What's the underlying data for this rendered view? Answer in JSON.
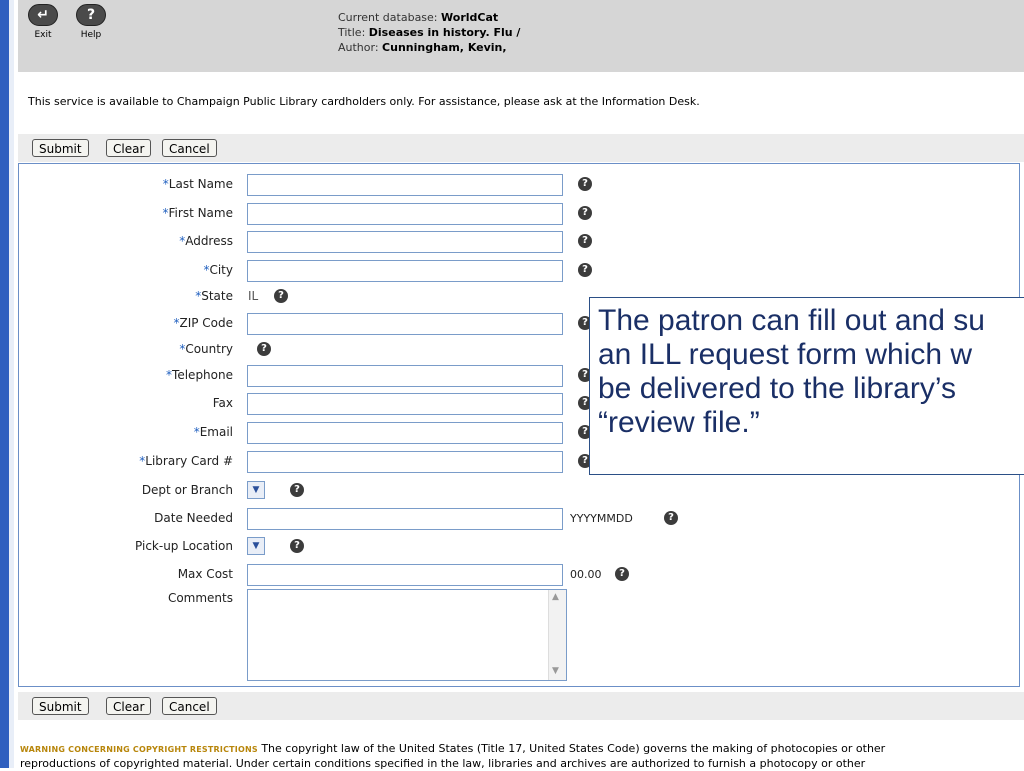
{
  "header": {
    "exit_label": "Exit",
    "help_label": "Help",
    "db_prefix": "Current database:",
    "db_value": "WorldCat",
    "title_prefix": "Title:",
    "title_value": "Diseases in history. Flu /",
    "author_prefix": "Author:",
    "author_value": "Cunningham, Kevin,"
  },
  "notice": "This service is available to Champaign Public Library cardholders only. For assistance, please ask at the Information Desk.",
  "buttons": {
    "submit": "Submit",
    "clear": "Clear",
    "cancel": "Cancel"
  },
  "form": {
    "last_name": "Last Name",
    "first_name": "First Name",
    "address": "Address",
    "city": "City",
    "state": "State",
    "state_value": "IL",
    "zip": "ZIP Code",
    "country": "Country",
    "telephone": "Telephone",
    "fax": "Fax",
    "email": "Email",
    "library_card": "Library Card #",
    "dept_branch": "Dept or Branch",
    "date_needed": "Date Needed",
    "date_format": "YYYYMMDD",
    "pickup": "Pick-up Location",
    "max_cost": "Max Cost",
    "max_cost_value": "00.00",
    "comments": "Comments",
    "required_mark": "*"
  },
  "callout": {
    "line1": "The patron can fill out and su",
    "line2": "an ILL request form which w",
    "line3": "be delivered to the library’s",
    "line4": "“review file.”"
  },
  "warning": {
    "heading": "WARNING CONCERNING COPYRIGHT RESTRICTIONS",
    "text": " The copyright law of the United States (Title 17, United States Code) governs the making of photocopies or other",
    "text2": "reproductions of copyrighted material. Under certain conditions specified in the law, libraries and archives are authorized to furnish a photocopy or other"
  },
  "icons": {
    "help": "question-mark",
    "exit": "return-arrow",
    "dropdown": "chevron-down"
  }
}
